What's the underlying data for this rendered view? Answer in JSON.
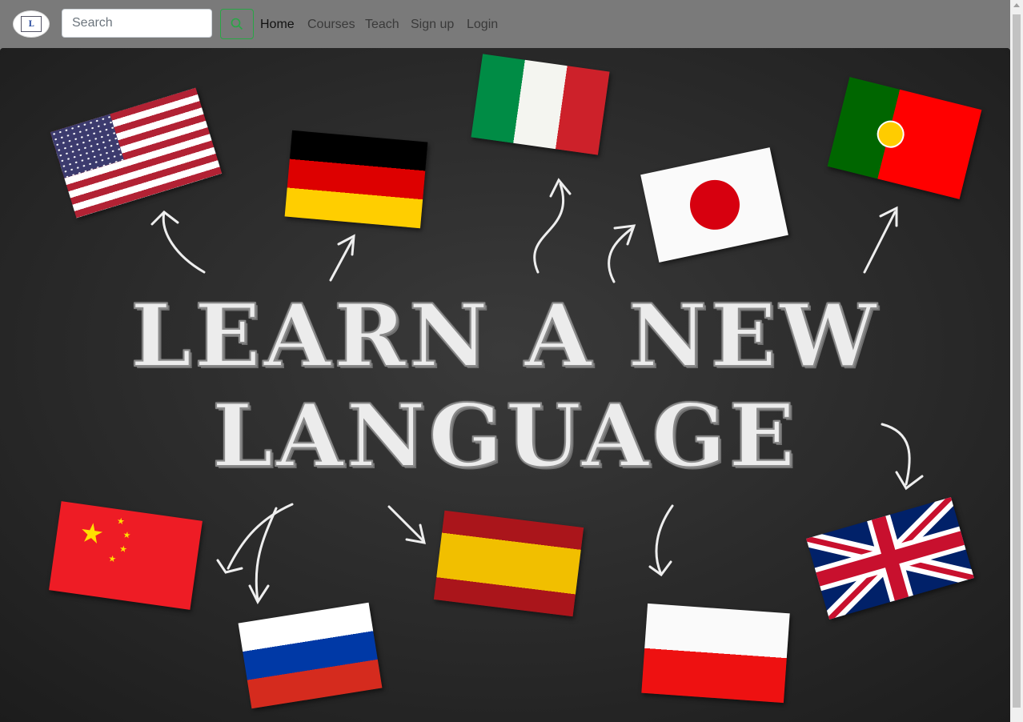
{
  "nav": {
    "search_placeholder": "Search",
    "links": [
      "Home",
      "Courses",
      "Teach",
      "Sign up",
      "Login"
    ],
    "active": "Home",
    "search_button_color": "#28a745"
  },
  "logo": {
    "text": "L"
  },
  "hero": {
    "line1": "LEARN A NEW",
    "line2": "LANGUAGE",
    "background": "#2b2b2b"
  }
}
